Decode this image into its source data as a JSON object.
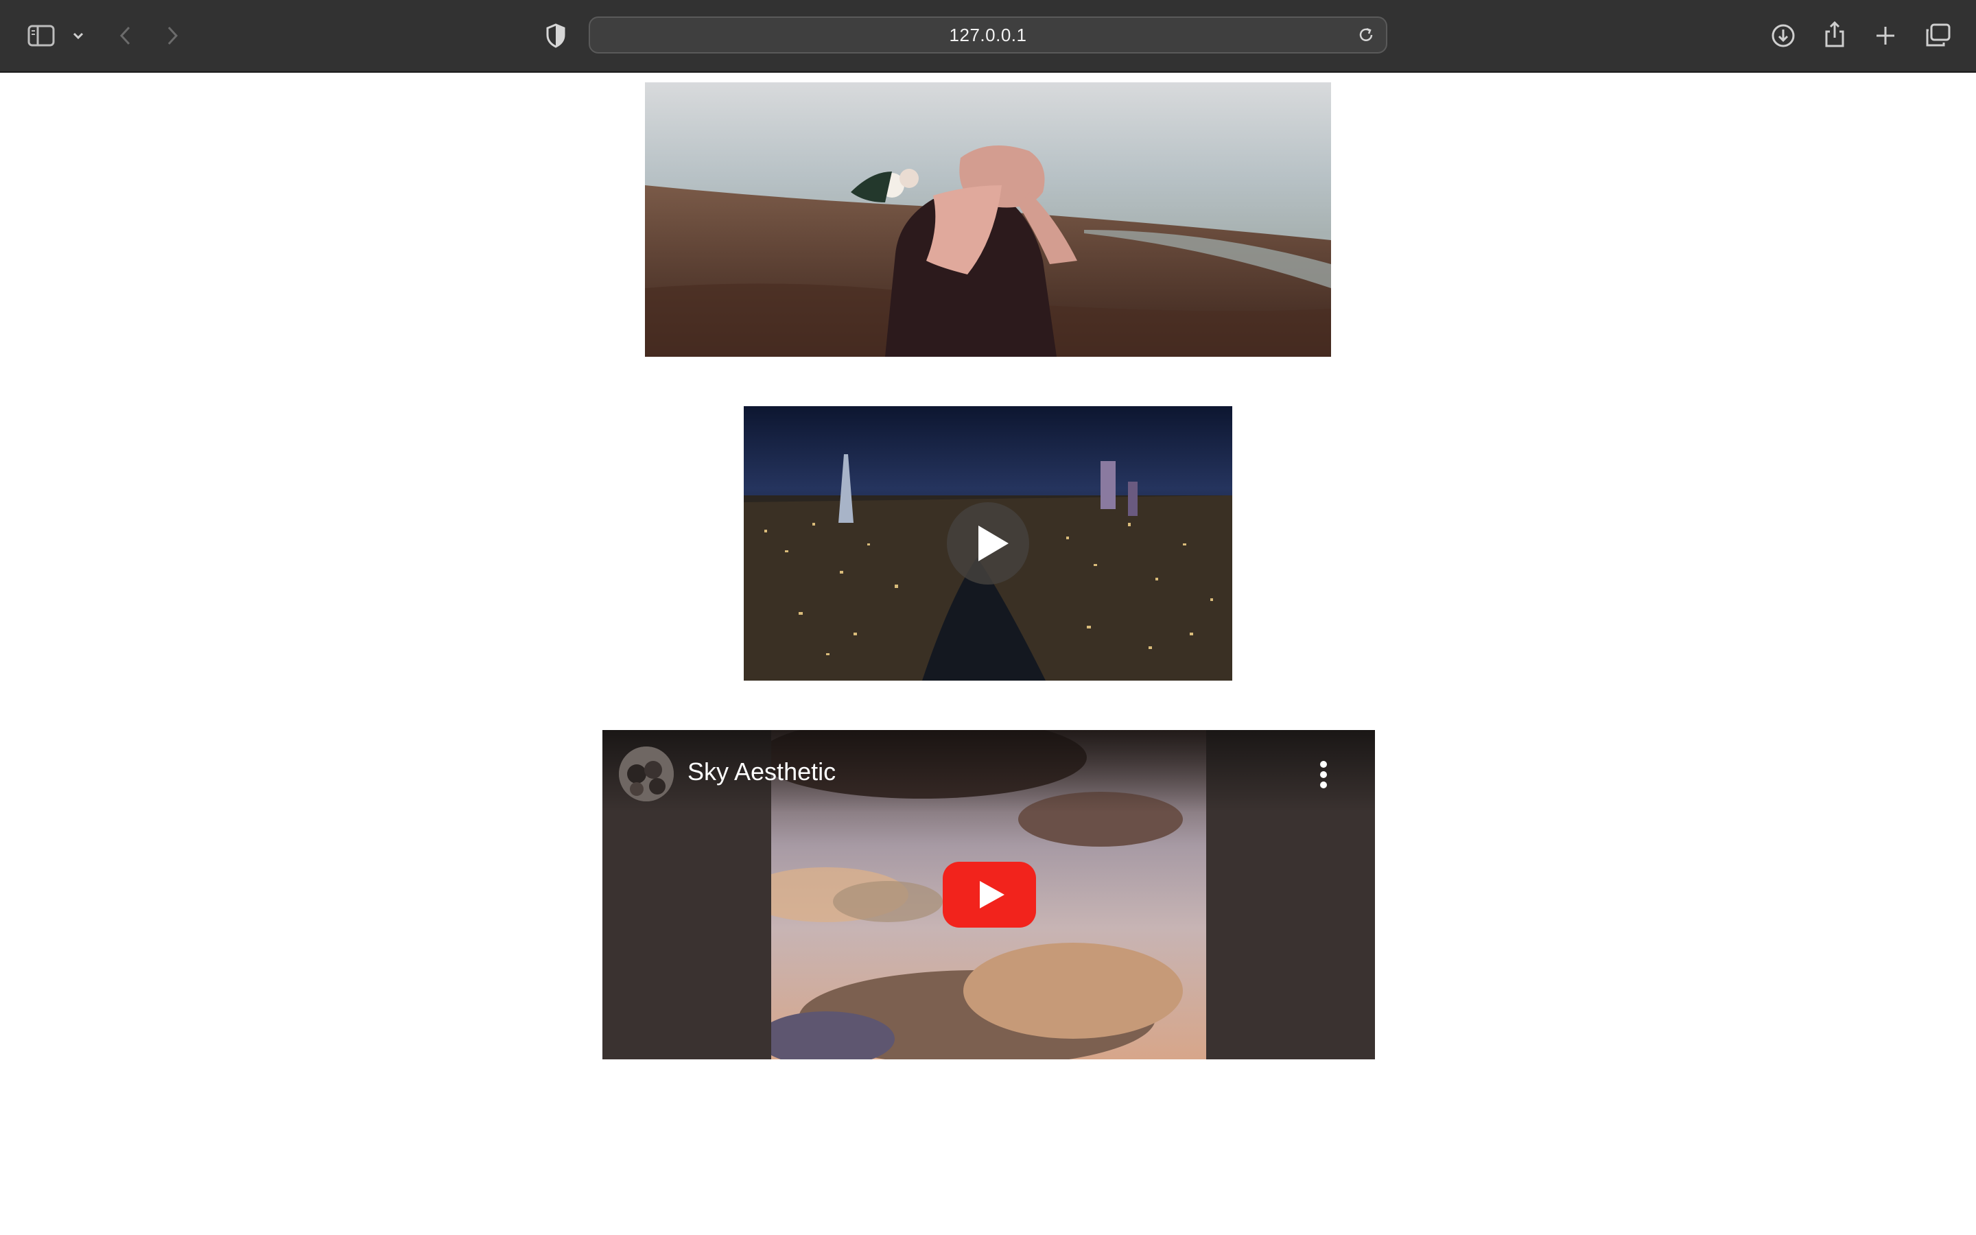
{
  "browser": {
    "url": "127.0.0.1",
    "icons": {
      "sidebar": "sidebar-icon",
      "dropdown": "chevron-down-icon",
      "back": "back-arrow-icon",
      "forward": "forward-arrow-icon",
      "privacy": "shield-icon",
      "reload": "reload-icon",
      "download": "download-icon",
      "share": "share-icon",
      "new_tab": "plus-icon",
      "tabs": "tab-overview-icon"
    }
  },
  "page": {
    "image": {
      "description_icon": "photo-woman-hijab-field"
    },
    "video": {
      "play_icon": "play-icon"
    },
    "youtube": {
      "title": "Sky Aesthetic",
      "play_icon": "youtube-play-icon",
      "menu_icon": "more-vertical-icon"
    }
  },
  "colors": {
    "toolbar_bg": "#323232",
    "youtube_red": "#ff0000",
    "page_bg": "#ffffff"
  }
}
